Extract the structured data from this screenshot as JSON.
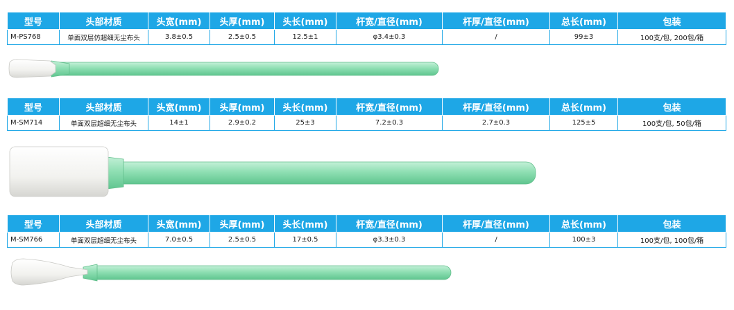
{
  "columns": [
    "型号",
    "头部材质",
    "头宽(mm)",
    "头厚(mm)",
    "头长(mm)",
    "杆宽/直径(mm)",
    "杆厚/直径(mm)",
    "总长(mm)",
    "包装"
  ],
  "products": [
    {
      "model": "M-PS768",
      "material": "单面双层仿超细无尘布头",
      "head_width": "3.8±0.5",
      "head_thickness": "2.5±0.5",
      "head_length": "12.5±1",
      "shaft_width": "φ3.4±0.3",
      "shaft_thickness": "/",
      "total_length": "99±3",
      "packaging": "100支/包, 200包/箱"
    },
    {
      "model": "M-SM714",
      "material": "单面双层超细无尘布头",
      "head_width": "14±1",
      "head_thickness": "2.9±0.2",
      "head_length": "25±3",
      "shaft_width": "7.2±0.3",
      "shaft_thickness": "2.7±0.3",
      "total_length": "125±5",
      "packaging": "100支/包, 50包/箱"
    },
    {
      "model": "M-SM766",
      "material": "单面双层超细无尘布头",
      "head_width": "7.0±0.5",
      "head_thickness": "2.5±0.5",
      "head_length": "17±0.5",
      "shaft_width": "φ3.3±0.3",
      "shaft_thickness": "/",
      "total_length": "100±3",
      "packaging": "100支/包, 100包/箱"
    }
  ],
  "colors": {
    "header_bg": "#1ea7e6",
    "shaft_green": "#8ee0b4",
    "head_white": "#f4f4f2"
  }
}
